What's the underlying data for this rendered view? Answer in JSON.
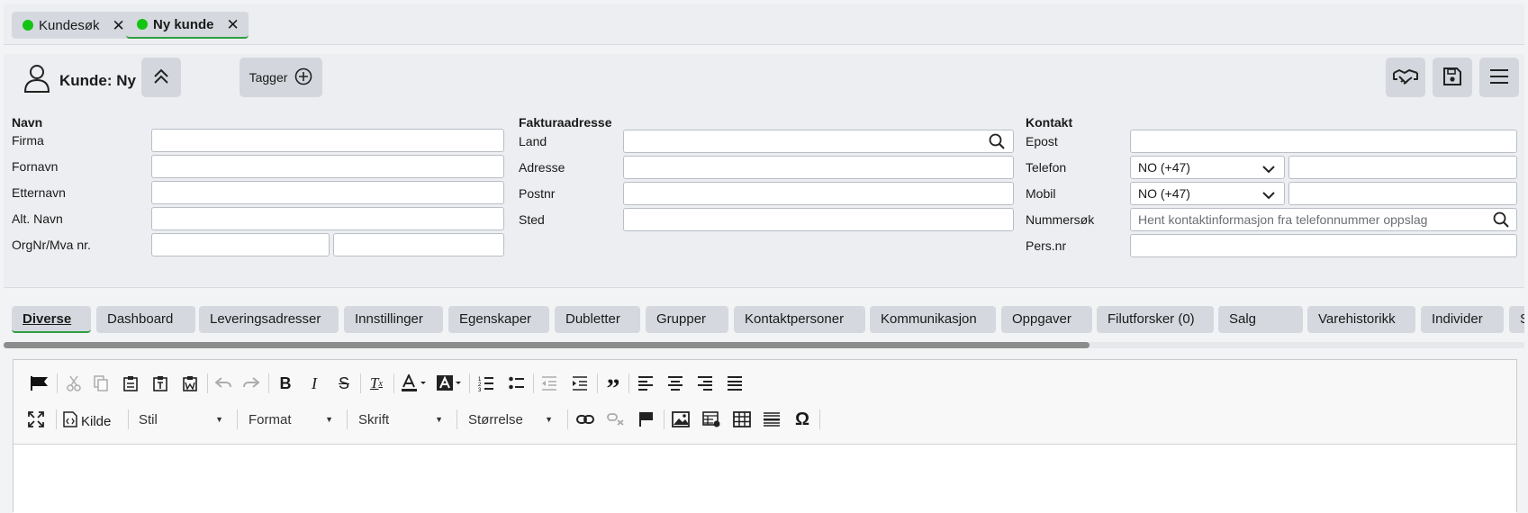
{
  "doc_tabs": [
    {
      "label": "Kundesøk",
      "status_color": "#14c414"
    },
    {
      "label": "Ny kunde",
      "status_color": "#14c414"
    }
  ],
  "header": {
    "title": "Kunde: Ny",
    "tagger_label": "Tagger"
  },
  "navn": {
    "heading": "Navn",
    "firma": {
      "label": "Firma",
      "value": ""
    },
    "fornavn": {
      "label": "Fornavn",
      "value": ""
    },
    "etternavn": {
      "label": "Etternavn",
      "value": ""
    },
    "alt_navn": {
      "label": "Alt. Navn",
      "value": ""
    },
    "orgnr": {
      "label": "OrgNr/Mva nr.",
      "value": "",
      "value2": ""
    }
  },
  "faktura": {
    "heading": "Fakturaadresse",
    "land": {
      "label": "Land",
      "value": ""
    },
    "adresse": {
      "label": "Adresse",
      "value": ""
    },
    "postnr": {
      "label": "Postnr",
      "value": ""
    },
    "sted": {
      "label": "Sted",
      "value": ""
    }
  },
  "kontakt": {
    "heading": "Kontakt",
    "epost": {
      "label": "Epost",
      "value": ""
    },
    "telefon": {
      "label": "Telefon",
      "country": "NO (+47)",
      "value": ""
    },
    "mobil": {
      "label": "Mobil",
      "country": "NO (+47)",
      "value": ""
    },
    "nummersok": {
      "label": "Nummersøk",
      "placeholder": "Hent kontaktinformasjon fra telefonnummer oppslag"
    },
    "persnr": {
      "label": "Pers.nr",
      "value": ""
    }
  },
  "section_tabs": [
    "Diverse",
    "Dashboard",
    "Leveringsadresser",
    "Innstillinger",
    "Egenskaper",
    "Dubletter",
    "Grupper",
    "Kontaktpersoner",
    "Kommunikasjon",
    "Oppgaver",
    "Filutforsker (0)",
    "Salg",
    "Varehistorikk",
    "Individer",
    "Se"
  ],
  "editor": {
    "kilde_label": "Kilde",
    "combos": {
      "stil": "Stil",
      "format": "Format",
      "skrift": "Skrift",
      "storrelse": "Størrelse"
    }
  },
  "colors": {
    "accent": "#2e9e40",
    "status_dot": "#14c414"
  }
}
